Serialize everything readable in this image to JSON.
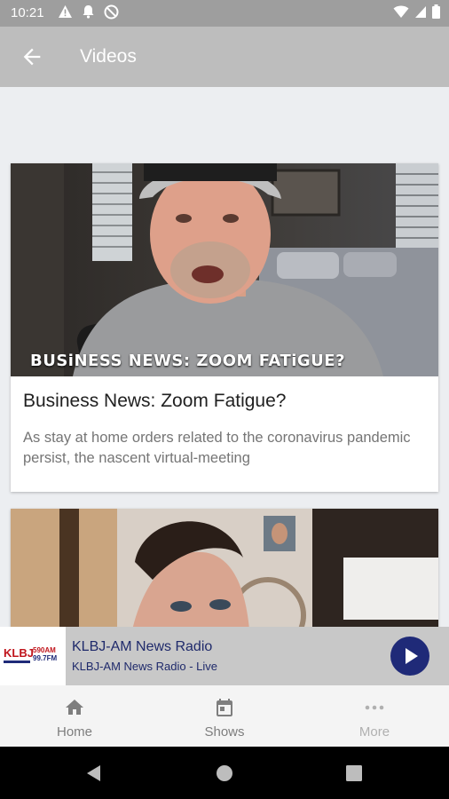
{
  "status_bar": {
    "time": "10:21",
    "left_icons": [
      "warning-icon",
      "notification-bell-icon",
      "do-not-disturb-icon"
    ],
    "right_icons": [
      "wifi-icon",
      "cellular-signal-icon",
      "battery-icon"
    ]
  },
  "app_bar": {
    "back_icon": "arrow-left-icon",
    "title": "Videos"
  },
  "videos": [
    {
      "thumbnail_caption": "BUSiNESS NEWS: ZOOM FATiGUE?",
      "title": "Business News: Zoom Fatigue?",
      "description": "As stay at home orders related to the coronavirus pandemic persist, the nascent virtual-meeting"
    },
    {
      "thumbnail_caption": "",
      "title": "",
      "description": ""
    }
  ],
  "now_playing": {
    "logo_text_top": "KLBJ",
    "logo_text_am": "590AM",
    "logo_text_fm": "99.7FM",
    "station": "KLBJ-AM News Radio",
    "subtitle": "KLBJ-AM News Radio - Live",
    "play_icon": "play-icon"
  },
  "bottom_nav": [
    {
      "label": "Home",
      "icon": "home-icon"
    },
    {
      "label": "Shows",
      "icon": "calendar-icon"
    },
    {
      "label": "More",
      "icon": "more-horizontal-icon"
    }
  ],
  "colors": {
    "app_bar": "#bdbdbd",
    "status_bar": "#9e9e9e",
    "player_bg": "#c8c8c8",
    "accent_navy": "#1f2a78",
    "page_bg": "#eceef1"
  }
}
